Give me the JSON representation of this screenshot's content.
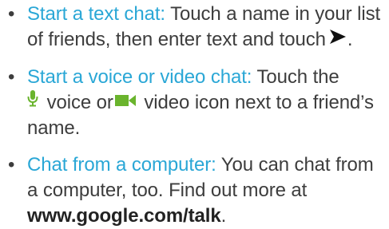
{
  "items": [
    {
      "lead": "Start a text chat:",
      "text": " Touch a name in your list of friends, then enter text and touch",
      "end": "."
    },
    {
      "lead": "Start a voice or video chat:",
      "text1": " Touch the",
      "text2": " voice or",
      "text3": " video icon next to a friend’s name."
    },
    {
      "lead": "Chat from a computer:",
      "text": " You can chat from a computer, too. Find out more at ",
      "link": "www.google.com/talk",
      "end": "."
    }
  ],
  "bullet": "•",
  "icons": {
    "send": "send-arrow-icon",
    "mic": "microphone-icon",
    "video": "video-camera-icon"
  },
  "colors": {
    "accent": "#2aa7d6",
    "text": "#3d3d3d",
    "icon_green": "#6ab42d",
    "send_icon": "#111111"
  }
}
